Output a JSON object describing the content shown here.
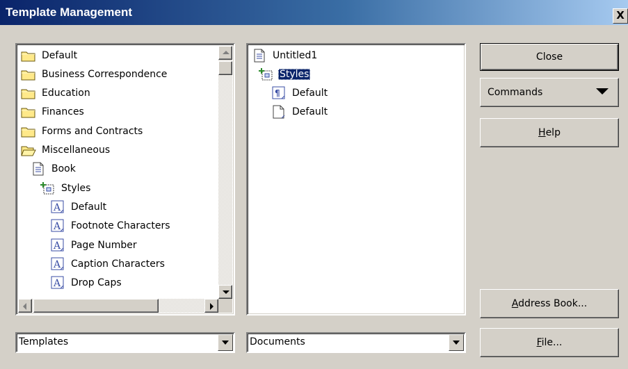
{
  "window": {
    "title": "Template Management",
    "close_glyph": "X"
  },
  "left_tree": {
    "items": [
      {
        "label": "Default",
        "icon": "folder-icon"
      },
      {
        "label": "Business Correspondence",
        "icon": "folder-icon"
      },
      {
        "label": "Education",
        "icon": "folder-icon"
      },
      {
        "label": "Finances",
        "icon": "folder-icon"
      },
      {
        "label": "Forms and Contracts",
        "icon": "folder-icon"
      },
      {
        "label": "Miscellaneous",
        "icon": "folder-open-icon"
      },
      {
        "label": "Book",
        "icon": "document-icon"
      },
      {
        "label": "Styles",
        "icon": "styles-icon"
      },
      {
        "label": "Default",
        "icon": "character-style-icon"
      },
      {
        "label": "Footnote Characters",
        "icon": "character-style-icon"
      },
      {
        "label": "Page Number",
        "icon": "character-style-icon"
      },
      {
        "label": "Caption Characters",
        "icon": "character-style-icon"
      },
      {
        "label": "Drop Caps",
        "icon": "character-style-icon"
      }
    ]
  },
  "right_tree": {
    "items": [
      {
        "label": "Untitled1",
        "icon": "document-icon",
        "selected": false
      },
      {
        "label": "Styles",
        "icon": "styles-icon",
        "selected": true
      },
      {
        "label": "Default",
        "icon": "paragraph-style-icon",
        "selected": false
      },
      {
        "label": "Default",
        "icon": "page-style-icon",
        "selected": false
      }
    ]
  },
  "buttons": {
    "close": "Close",
    "commands": "Commands",
    "help_u": "H",
    "help_rest": "elp",
    "address_u": "A",
    "address_rest": "ddress Book...",
    "file_u": "F",
    "file_rest": "ile..."
  },
  "selects": {
    "left": {
      "value": "Templates"
    },
    "right": {
      "value": "Documents"
    }
  },
  "colors": {
    "title_start": "#0a246a",
    "title_end": "#a6caf0",
    "selection": "#0a246a",
    "face": "#d4d0c8"
  }
}
